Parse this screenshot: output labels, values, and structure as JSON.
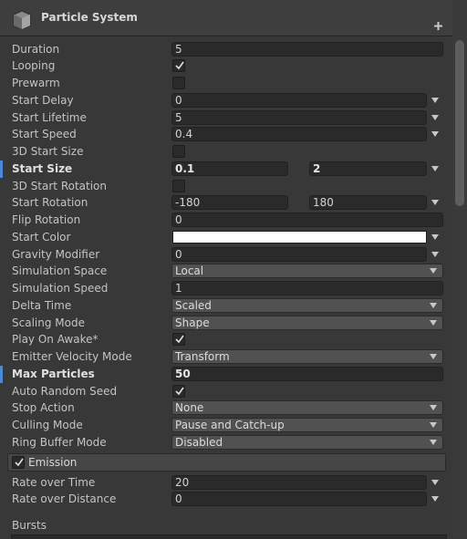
{
  "header": {
    "title": "Particle System",
    "icon": "cube-icon",
    "plus_icon": "plus-icon"
  },
  "rows": {
    "duration": {
      "label": "Duration",
      "value": "5"
    },
    "looping": {
      "label": "Looping",
      "checked": true
    },
    "prewarm": {
      "label": "Prewarm",
      "checked": false
    },
    "start_delay": {
      "label": "Start Delay",
      "value": "0"
    },
    "start_lifetime": {
      "label": "Start Lifetime",
      "value": "5"
    },
    "start_speed": {
      "label": "Start Speed",
      "value": "0.4"
    },
    "start_size_3d": {
      "label": "3D Start Size",
      "checked": false
    },
    "start_size": {
      "label": "Start Size",
      "min": "0.1",
      "max": "2"
    },
    "start_rotation_3d": {
      "label": "3D Start Rotation",
      "checked": false
    },
    "start_rotation": {
      "label": "Start Rotation",
      "min": "-180",
      "max": "180"
    },
    "flip_rotation": {
      "label": "Flip Rotation",
      "value": "0"
    },
    "start_color": {
      "label": "Start Color",
      "color": "#ffffff"
    },
    "gravity_modifier": {
      "label": "Gravity Modifier",
      "value": "0"
    },
    "simulation_space": {
      "label": "Simulation Space",
      "value": "Local"
    },
    "simulation_speed": {
      "label": "Simulation Speed",
      "value": "1"
    },
    "delta_time": {
      "label": "Delta Time",
      "value": "Scaled"
    },
    "scaling_mode": {
      "label": "Scaling Mode",
      "value": "Shape"
    },
    "play_on_awake": {
      "label": "Play On Awake*",
      "checked": true
    },
    "emitter_velocity_mode": {
      "label": "Emitter Velocity Mode",
      "value": "Transform"
    },
    "max_particles": {
      "label": "Max Particles",
      "value": "50"
    },
    "auto_random_seed": {
      "label": "Auto Random Seed",
      "checked": true
    },
    "stop_action": {
      "label": "Stop Action",
      "value": "None"
    },
    "culling_mode": {
      "label": "Culling Mode",
      "value": "Pause and Catch-up"
    },
    "ring_buffer_mode": {
      "label": "Ring Buffer Mode",
      "value": "Disabled"
    }
  },
  "emission": {
    "title": "Emission",
    "enabled": true,
    "rate_over_time": {
      "label": "Rate over Time",
      "value": "20"
    },
    "rate_over_distance": {
      "label": "Rate over Distance",
      "value": "0"
    },
    "bursts": {
      "label": "Bursts"
    }
  },
  "colors": {
    "panel": "#383838",
    "field": "#2a2a2a",
    "dropdown": "#515151",
    "accent": "#4a8ad8"
  }
}
